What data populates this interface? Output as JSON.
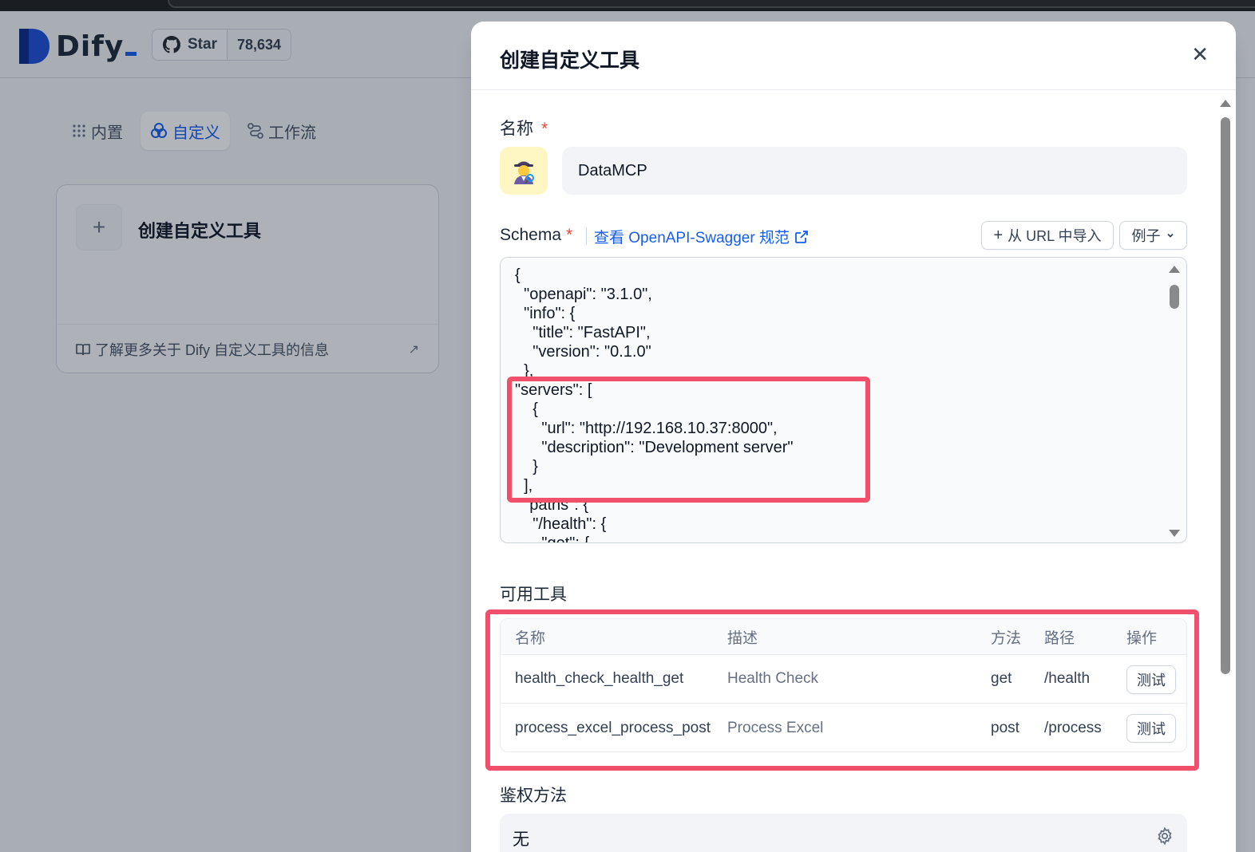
{
  "app": {
    "brand": "Dify",
    "github": {
      "star_label": "Star",
      "star_count": "78,634"
    },
    "tabs": [
      {
        "label": "内置",
        "icon": "grid-dots-icon",
        "active": false
      },
      {
        "label": "自定义",
        "icon": "custom-circles-icon",
        "active": true
      },
      {
        "label": "工作流",
        "icon": "workflow-icon",
        "active": false
      }
    ],
    "create_card": {
      "title": "创建自定义工具",
      "footer_link": "了解更多关于 Dify 自定义工具的信息"
    }
  },
  "modal": {
    "title": "创建自定义工具",
    "name_label": "名称",
    "required_mark": "*",
    "name_value": "DataMCP",
    "schema_label": "Schema",
    "swagger_link": "查看 OpenAPI-Swagger 规范",
    "import_url_button": "从 URL 中导入",
    "example_button": "例子",
    "schema_code": "{\n  \"openapi\": \"3.1.0\",\n  \"info\": {\n    \"title\": \"FastAPI\",\n    \"version\": \"0.1.0\"\n  },\n\"servers\": [\n    {\n      \"url\": \"http://192.168.10.37:8000\",\n      \"description\": \"Development server\"\n    }\n  ],\n  \"paths\": {\n    \"/health\": {\n      \"get\": {",
    "tools_label": "可用工具",
    "tools_table": {
      "headers": [
        "名称",
        "描述",
        "方法",
        "路径",
        "操作"
      ],
      "rows": [
        {
          "name": "health_check_health_get",
          "description": "Health Check",
          "method": "get",
          "path": "/health",
          "action": "测试"
        },
        {
          "name": "process_excel_process_post",
          "description": "Process Excel",
          "method": "post",
          "path": "/process",
          "action": "测试"
        }
      ]
    },
    "auth_label": "鉴权方法",
    "auth_value": "无"
  },
  "colors": {
    "accent": "#155eef",
    "required": "#f04438",
    "highlight": "#f0506a",
    "emoji_bg": "#fef7c3"
  }
}
